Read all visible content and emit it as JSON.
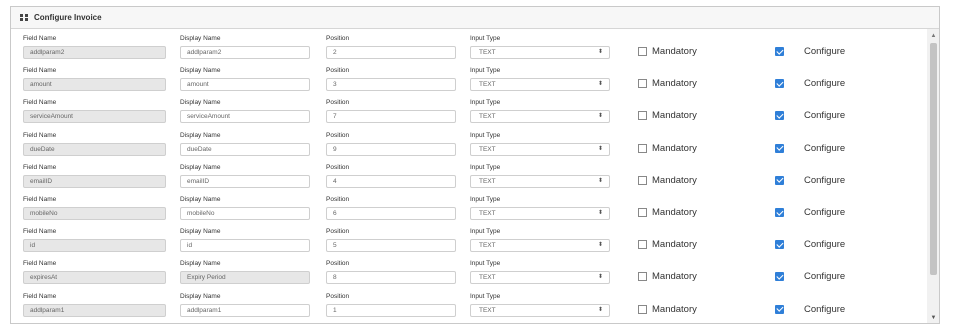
{
  "panel": {
    "title": "Configure Invoice"
  },
  "labels": {
    "field_name": "Field Name",
    "display_name": "Display Name",
    "position": "Position",
    "input_type": "Input Type"
  },
  "mandatory_label": "Mandatory",
  "configure_label": "Configure",
  "rows": [
    {
      "field": "addlparam2",
      "display": "addlparam2",
      "position": "2",
      "input_type": "TEXT",
      "display_readonly": false,
      "mandatory": false,
      "configure": true
    },
    {
      "field": "amount",
      "display": "amount",
      "position": "3",
      "input_type": "TEXT",
      "display_readonly": false,
      "mandatory": false,
      "configure": true
    },
    {
      "field": "serviceAmount",
      "display": "serviceAmount",
      "position": "7",
      "input_type": "TEXT",
      "display_readonly": false,
      "mandatory": false,
      "configure": true
    },
    {
      "field": "dueDate",
      "display": "dueDate",
      "position": "9",
      "input_type": "TEXT",
      "display_readonly": false,
      "mandatory": false,
      "configure": true
    },
    {
      "field": "emailID",
      "display": "emailID",
      "position": "4",
      "input_type": "TEXT",
      "display_readonly": false,
      "mandatory": false,
      "configure": true
    },
    {
      "field": "mobileNo",
      "display": "mobileNo",
      "position": "6",
      "input_type": "TEXT",
      "display_readonly": false,
      "mandatory": false,
      "configure": true
    },
    {
      "field": "id",
      "display": "id",
      "position": "5",
      "input_type": "TEXT",
      "display_readonly": false,
      "mandatory": false,
      "configure": true
    },
    {
      "field": "expiresAt",
      "display": "Expiry Period",
      "position": "8",
      "input_type": "TEXT",
      "display_readonly": true,
      "mandatory": false,
      "configure": true
    },
    {
      "field": "addlparam1",
      "display": "addlparam1",
      "position": "1",
      "input_type": "TEXT",
      "display_readonly": false,
      "mandatory": false,
      "configure": true
    }
  ],
  "icons": {
    "header": "grid-icon",
    "select_arrow": "sort-arrows-icon",
    "scroll_up": "scroll-up-icon",
    "scroll_down": "scroll-down-icon"
  },
  "colors": {
    "checked": "#2f7fd8",
    "readonly_field": "#e7e7e7"
  }
}
